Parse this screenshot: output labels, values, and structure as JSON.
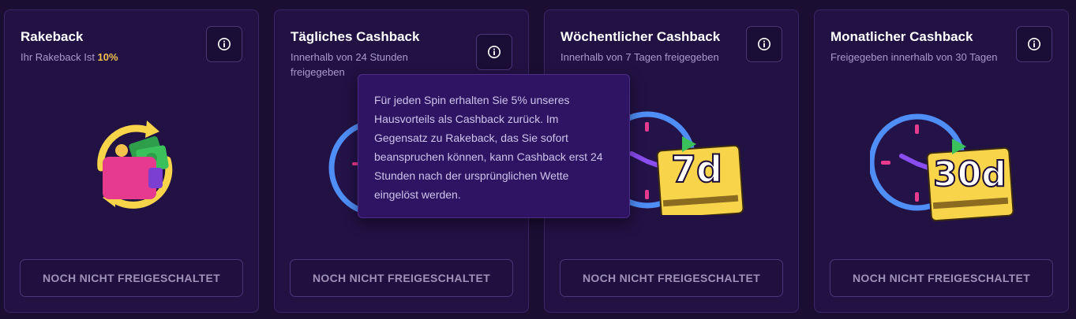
{
  "cards": [
    {
      "title": "Rakeback",
      "subtitle_prefix": "Ihr Rakeback Ist ",
      "subtitle_highlight": "10%",
      "button": "NOCH NICHT FREIGESCHALTET",
      "illustration": "wallet-cash-icon"
    },
    {
      "title": "Tägliches Cashback",
      "subtitle": "Innerhalb von 24 Stunden freigegeben",
      "button": "NOCH NICHT FREIGESCHALTET",
      "illustration": "clock-icon"
    },
    {
      "title": "Wöchentlicher Cashback",
      "subtitle": "Innerhalb von 7 Tagen freigegeben",
      "button": "NOCH NICHT FREIGESCHALTET",
      "illustration": "clock-ticket-icon",
      "badge": "7d"
    },
    {
      "title": "Monatlicher Cashback",
      "subtitle": "Freigegeben innerhalb von 30 Tagen",
      "button": "NOCH NICHT FREIGESCHALTET",
      "illustration": "clock-ticket-icon",
      "badge": "30d"
    }
  ],
  "tooltip": {
    "text": "Für jeden Spin erhalten Sie 5% unseres Hausvorteils als Cashback zurück. Im Gegensatz zu Rakeback, das Sie sofort beanspruchen können, kann Cashback erst 24 Stunden nach der ursprünglichen Wette eingelöst werden."
  },
  "colors": {
    "background": "#1a0e33",
    "card": "#221143",
    "accent_gold": "#f2c14e",
    "clock_blue": "#4f8ef7",
    "tooltip_bg": "#2f1463"
  }
}
